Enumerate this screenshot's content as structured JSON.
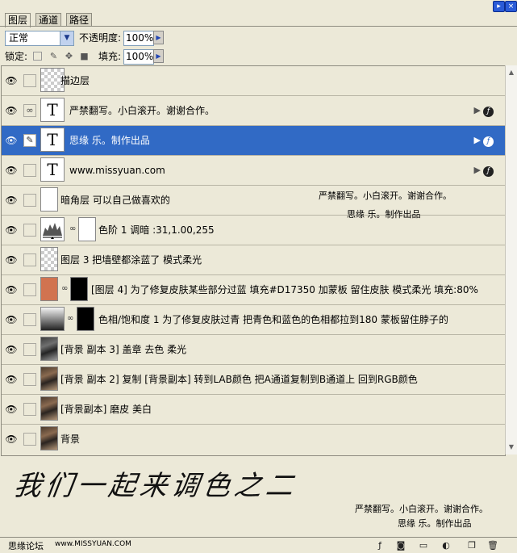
{
  "window": {
    "close_glyph": "×"
  },
  "tabs": [
    {
      "label": "图层"
    },
    {
      "label": "通道"
    },
    {
      "label": "路径"
    }
  ],
  "options": {
    "blend_mode": "正常",
    "opacity_label": "不透明度:",
    "opacity_value": "100%",
    "lock_label": "锁定:",
    "fill_label": "填充:",
    "fill_value": "100%"
  },
  "layers": [
    {
      "name": "描边层",
      "thumb": "checker",
      "selected": false
    },
    {
      "name": "严禁翻写。小白滚开。谢谢合作。",
      "thumb": "text",
      "selected": false
    },
    {
      "name": "思缘 乐。制作出品",
      "thumb": "text",
      "selected": true
    },
    {
      "name": "www.missyuan.com",
      "thumb": "text",
      "selected": false
    },
    {
      "name": "暗角层 可以自己做喜欢的",
      "thumb": "white",
      "selected": false
    },
    {
      "name": "色阶 1 调暗 :31,1.00,255",
      "thumb": "levels",
      "selected": false
    },
    {
      "name": "图层 3 把墙壁都涂蓝了 模式柔光",
      "thumb": "checker",
      "selected": false
    },
    {
      "name": "[图层 4] 为了修复皮肤某些部分过蓝 填充#D17350 加蒙板 留住皮肤 模式柔光 填充:80%",
      "thumb": "color",
      "selected": false
    },
    {
      "name": "色相/饱和度 1 为了修复皮肤过青 把青色和蓝色的色相都拉到180 蒙板留住脖子的",
      "thumb": "hue",
      "selected": false
    },
    {
      "name": "[背景 副本 3] 盖章 去色 柔光",
      "thumb": "photo",
      "selected": false
    },
    {
      "name": "[背景 副本 2] 复制 [背景副本] 转到LAB颜色 把A通道复制到B通道上 回到RGB颜色",
      "thumb": "photo",
      "selected": false
    },
    {
      "name": "[背景副本] 磨皮 美白",
      "thumb": "photo",
      "selected": false
    },
    {
      "name": "背景",
      "thumb": "photo",
      "selected": false
    }
  ],
  "overlay_text": {
    "line1": "严禁翻写。小白滚开。谢谢合作。",
    "line2": "思缘 乐。制作出品"
  },
  "handwriting": "我们一起来调色之二",
  "footer": {
    "forum": "思缘论坛",
    "url": "www.MISSYUAN.COM",
    "note1": "严禁翻写。小白滚开。谢谢合作。",
    "note2": "思缘 乐。制作出品"
  },
  "accent_color": "#316ac5",
  "fill_swatch": "#D17350"
}
